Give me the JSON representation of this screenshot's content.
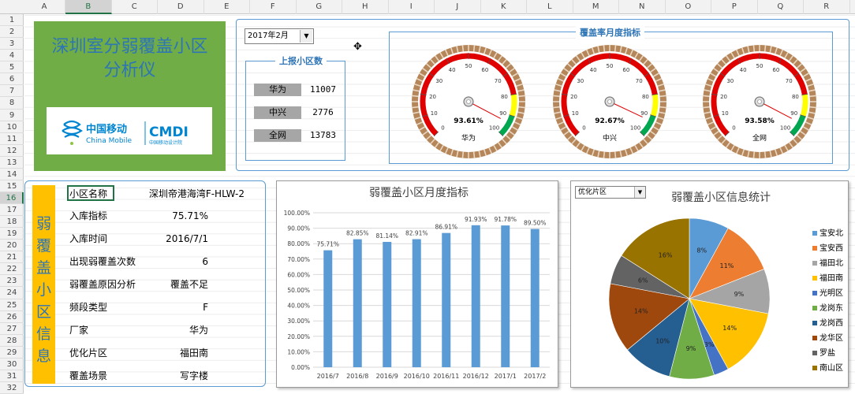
{
  "spreadsheet": {
    "columns": [
      "A",
      "B",
      "C",
      "D",
      "E",
      "F",
      "G",
      "H",
      "I",
      "J",
      "K",
      "L",
      "M",
      "N",
      "O",
      "P",
      "Q",
      "R"
    ],
    "rows": [
      "1",
      "2",
      "3",
      "4",
      "5",
      "6",
      "7",
      "8",
      "9",
      "10",
      "11",
      "12",
      "13",
      "14",
      "15",
      "16",
      "17",
      "18",
      "19",
      "20",
      "21",
      "22",
      "23",
      "24",
      "25",
      "26",
      "27",
      "28",
      "29",
      "30",
      "31",
      "32"
    ],
    "selected_column": "B",
    "selected_row": "16"
  },
  "title_panel": {
    "line1": "深圳室分弱覆盖小区",
    "line2": "分析仪",
    "logo_cn": "中国移动",
    "logo_en": "China Mobile",
    "logo_cmdi": "CMDI",
    "logo_cmdi_sub": "中国移动设计院"
  },
  "month_select": {
    "value": "2017年2月",
    "arrow_icon": "dropdown-arrow-icon"
  },
  "reported_cells": {
    "title": "上报小区数",
    "rows": [
      {
        "label": "华为",
        "value": "11007"
      },
      {
        "label": "中兴",
        "value": "2776"
      },
      {
        "label": "全网",
        "value": "13783"
      }
    ]
  },
  "gauges": {
    "title": "覆盖率月度指标",
    "ticks": [
      "0",
      "10",
      "20",
      "30",
      "40",
      "50",
      "60",
      "70",
      "80",
      "90",
      "100"
    ],
    "items": [
      {
        "value_pct": 93.61,
        "display": "93.61%",
        "label": "华为"
      },
      {
        "value_pct": 92.67,
        "display": "92.67%",
        "label": "中兴"
      },
      {
        "value_pct": 93.58,
        "display": "93.58%",
        "label": "全网"
      }
    ],
    "colors": {
      "red": "#e00000",
      "yellow": "#ffff00",
      "green": "#00a650",
      "rim": "#b5865a"
    }
  },
  "info_panel": {
    "side_title": [
      "弱",
      "覆",
      "盖",
      "小",
      "区",
      "信",
      "息"
    ],
    "header_label": "小区名称",
    "header_value": "深圳帝港海湾F-HLW-2",
    "fields": [
      {
        "label": "入库指标",
        "value": "75.71%"
      },
      {
        "label": "入库时间",
        "value": "2016/7/1"
      },
      {
        "label": "出现弱覆盖次数",
        "value": "6"
      },
      {
        "label": "弱覆盖原因分析",
        "value": "覆盖不足"
      },
      {
        "label": "频段类型",
        "value": "F"
      },
      {
        "label": "厂家",
        "value": "华为"
      },
      {
        "label": "优化片区",
        "value": "福田南"
      },
      {
        "label": "覆盖场景",
        "value": "写字楼"
      }
    ]
  },
  "chart_data": [
    {
      "type": "bar",
      "title": "弱覆盖小区月度指标",
      "categories": [
        "2016/7",
        "2016/8",
        "2016/9",
        "2016/10",
        "2016/11",
        "2016/12",
        "2017/1",
        "2017/2"
      ],
      "values": [
        75.71,
        82.85,
        81.14,
        82.91,
        86.91,
        91.93,
        91.78,
        89.5
      ],
      "data_labels": [
        "75.71%",
        "82.85%",
        "81.14%",
        "82.91%",
        "86.91%",
        "91.93%",
        "91.78%",
        "89.50%"
      ],
      "ylim": [
        0,
        100
      ],
      "yticks": [
        "0.00%",
        "10.00%",
        "20.00%",
        "30.00%",
        "40.00%",
        "50.00%",
        "60.00%",
        "70.00%",
        "80.00%",
        "90.00%",
        "100.00%"
      ],
      "grid": true,
      "color": "#5b9bd5"
    },
    {
      "type": "pie",
      "title": "弱覆盖小区信息统计",
      "filter": "优化片区",
      "categories": [
        "宝安北",
        "宝安西",
        "福田北",
        "福田南",
        "光明区",
        "龙岗东",
        "龙岗西",
        "龙华区",
        "罗盐",
        "南山区"
      ],
      "values": [
        8,
        11,
        9,
        14,
        3,
        9,
        10,
        14,
        6,
        16
      ],
      "labels": [
        "8%",
        "11%",
        "9%",
        "14%",
        "3%",
        "9%",
        "10%",
        "14%",
        "6%",
        "16%"
      ],
      "colors": [
        "#5b9bd5",
        "#ed7d31",
        "#a5a5a5",
        "#ffc000",
        "#4472c4",
        "#70ad47",
        "#255e91",
        "#9e480e",
        "#636363",
        "#997300"
      ],
      "legend": "right"
    }
  ]
}
